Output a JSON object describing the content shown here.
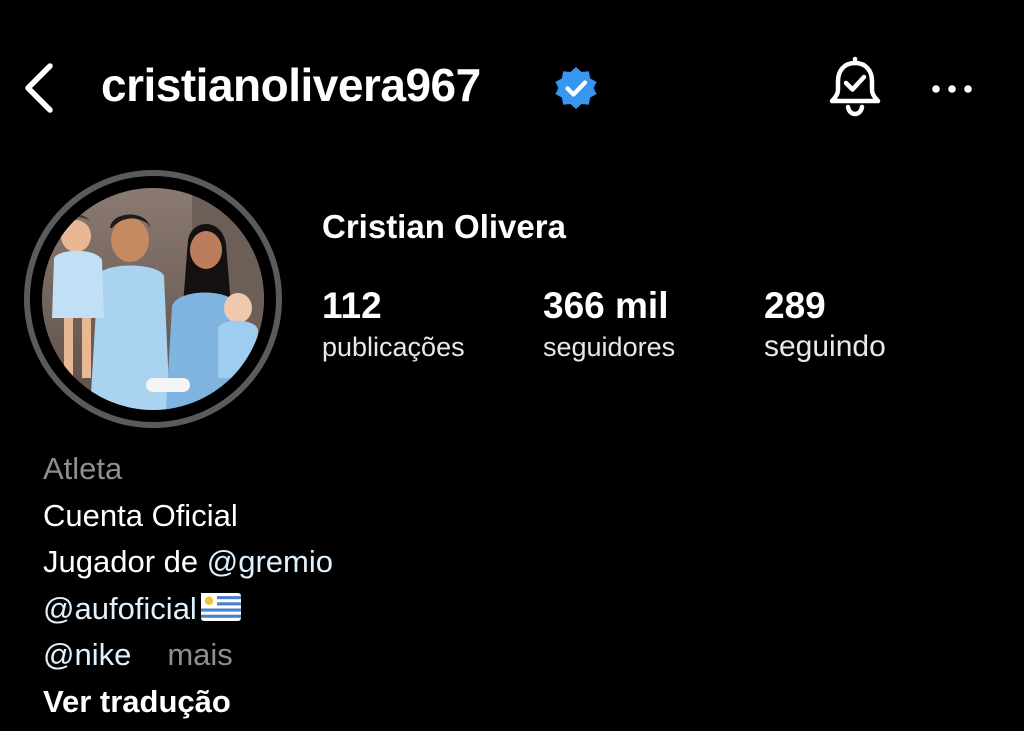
{
  "header": {
    "username": "cristianolivera967",
    "back_icon": "chevron-left-icon",
    "verified_icon": "verified-badge-icon",
    "notification_icon": "bell-check-icon",
    "more_icon": "ellipsis-icon"
  },
  "profile": {
    "full_name": "Cristian Olivera",
    "avatar": "profile-photo",
    "stats": [
      {
        "value": "112",
        "label": "publicações"
      },
      {
        "value": "366 mil",
        "label": "seguidores"
      },
      {
        "value": "289",
        "label": "seguindo"
      }
    ]
  },
  "bio": {
    "category": "Atleta",
    "line1": "Cuenta Oficial",
    "line2_prefix": "Jugador de ",
    "line2_mention": "@gremio",
    "line3_mention": "@aufoficial",
    "flag_icon": "uruguay-flag-icon",
    "line4_mention": "@nike",
    "more_label": "mais",
    "translate_label": "Ver tradução"
  },
  "colors": {
    "background": "#000000",
    "text": "#ffffff",
    "secondary_text": "#8e8e8e",
    "verified_blue": "#3797f0",
    "avatar_ring": "#5b5b5b"
  }
}
